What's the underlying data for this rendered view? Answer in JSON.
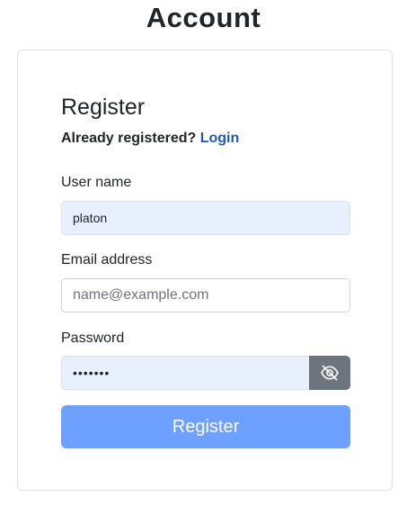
{
  "page": {
    "title": "Account"
  },
  "form": {
    "title": "Register",
    "already_registered_text": "Already registered?",
    "login_link_label": "Login",
    "username": {
      "label": "User name",
      "value": "platon"
    },
    "email": {
      "label": "Email address",
      "value": "",
      "placeholder": "name@example.com"
    },
    "password": {
      "label": "Password",
      "masked_value": "•••••••",
      "toggle_icon": "eye-slash-icon"
    },
    "submit_label": "Register"
  },
  "colors": {
    "link": "#1e5ab6",
    "autofill_background": "#e8f0fe",
    "toggle_button": "#6c757d",
    "submit_button": "#6ea0ff"
  }
}
